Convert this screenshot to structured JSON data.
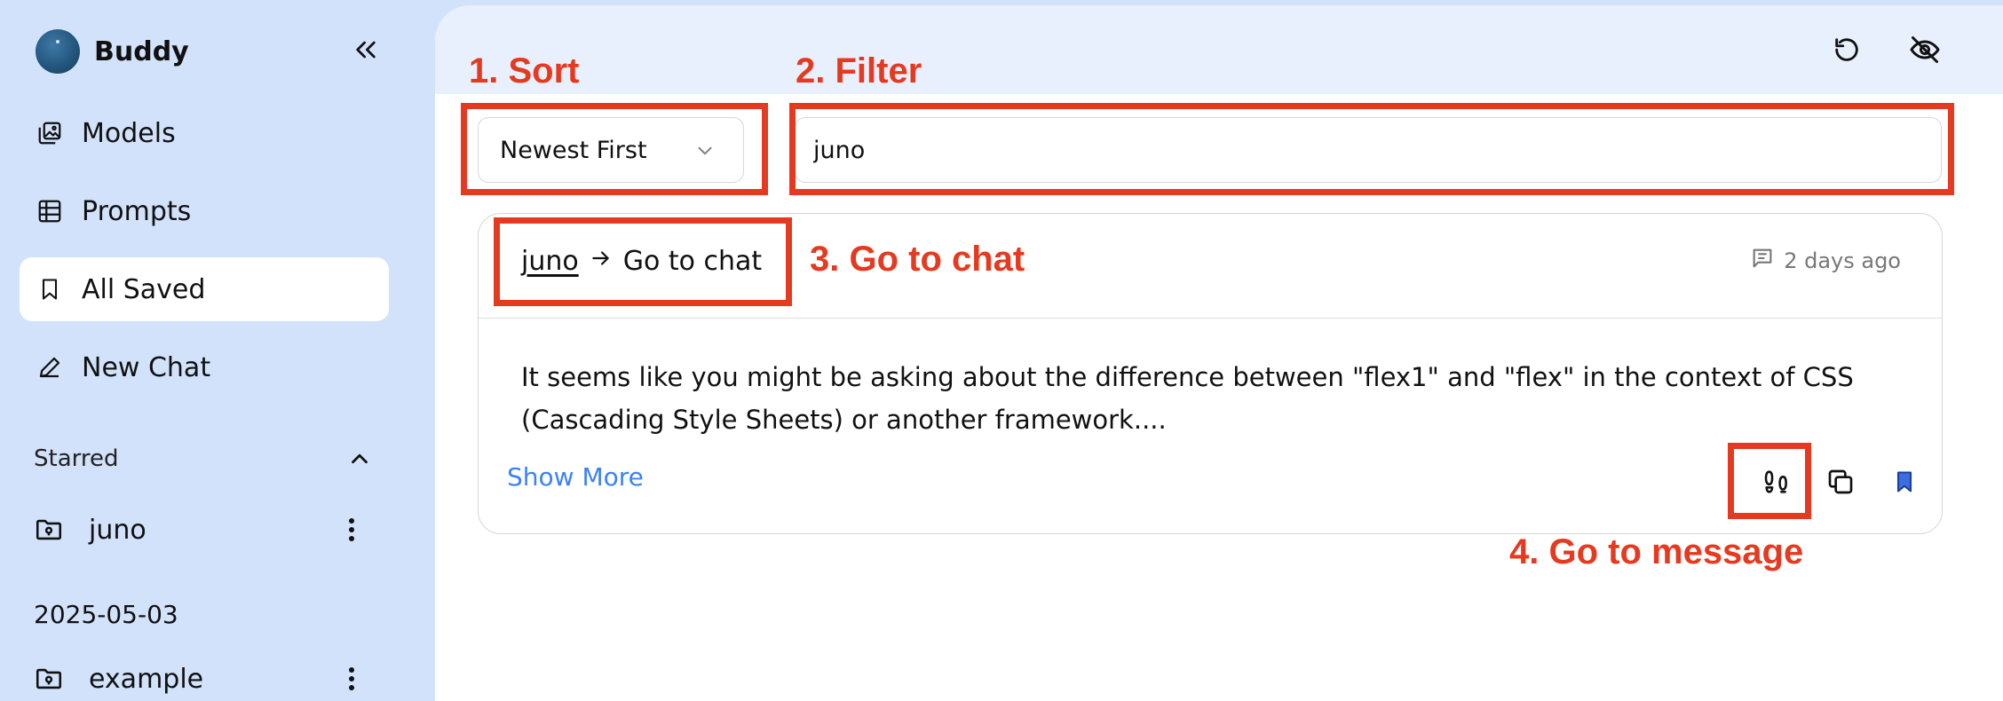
{
  "sidebar": {
    "brand": "Buddy",
    "nav": [
      {
        "label": "Models",
        "icon": "gallery-icon"
      },
      {
        "label": "Prompts",
        "icon": "table-icon"
      },
      {
        "label": "All Saved",
        "icon": "bookmark-icon",
        "active": true
      },
      {
        "label": "New Chat",
        "icon": "pencil-icon"
      }
    ],
    "starred_label": "Starred",
    "starred_items": [
      {
        "label": "juno",
        "icon": "folder-icon"
      }
    ],
    "date_group": "2025-05-03",
    "date_items": [
      {
        "label": "example",
        "icon": "folder-icon"
      }
    ]
  },
  "toolbar": {
    "sort_value": "Newest First",
    "filter_value": "juno"
  },
  "card": {
    "chat_name": "juno",
    "go_to_chat": "Go to chat",
    "time": "2 days ago",
    "message_line1": "It seems like you might be asking about the difference between \"flex1\" and \"flex\" in the context of CSS",
    "message_line2": "(Cascading Style Sheets) or another framework....",
    "show_more": "Show More"
  },
  "annotations": {
    "sort": "1. Sort",
    "filter": "2. Filter",
    "go_to_chat": "3. Go to chat",
    "go_to_message": "4. Go to message"
  },
  "colors": {
    "annotation": "#e53a20",
    "accent_blue": "#3b82f6",
    "sidebar_bg": "#d2e2fb",
    "bookmark_fill": "#3b6fe0"
  }
}
